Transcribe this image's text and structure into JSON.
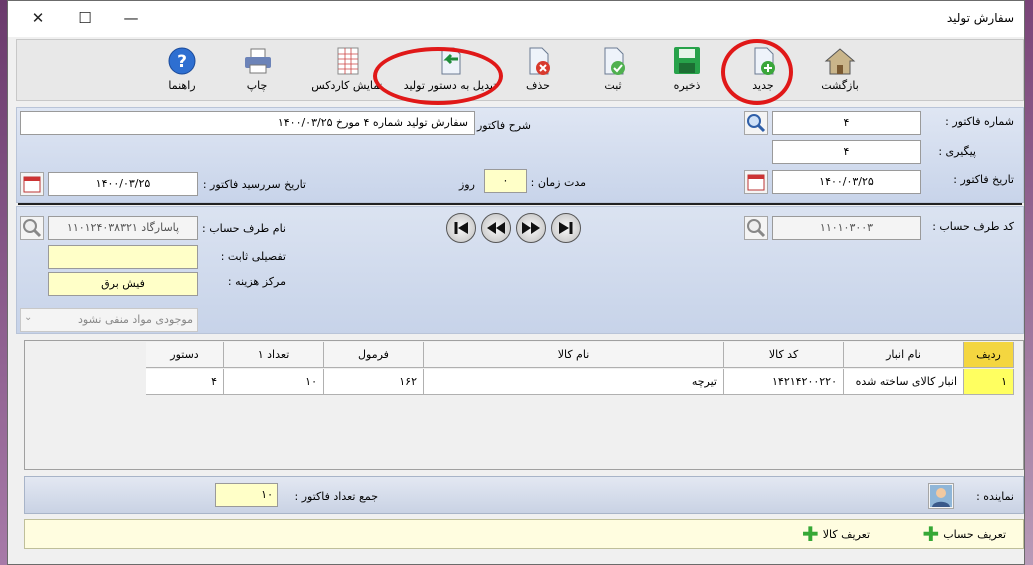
{
  "window": {
    "title": "سفارش تولید",
    "minimize": "—",
    "maximize": "☐",
    "close": "✕"
  },
  "toolbar": {
    "back": "بازگشت",
    "new": "جدید",
    "save": "ذخیره",
    "commit": "ثبت",
    "delete": "حذف",
    "convert": "تبدیل به دستور تولید",
    "kardex": "نمایش کاردکس",
    "print": "چاپ",
    "help": "راهنما"
  },
  "header": {
    "invoice_number_label": "شماره فاکتور :",
    "invoice_number": "۴",
    "tracking_label": "پیگیری :",
    "tracking": "۴",
    "invoice_date_label": "تاریخ فاکتور :",
    "invoice_date": "۱۴۰۰/۰۳/۲۵",
    "description_label": "شرح فاکتور :",
    "description": "سفارش تولید شماره ۴ مورخ ۱۴۰۰/۰۳/۲۵",
    "duration_label": "مدت زمان :",
    "duration": "۰",
    "duration_unit": "روز",
    "due_date_label": "تاریخ سررسید فاکتور :",
    "due_date": "۱۴۰۰/۰۳/۲۵"
  },
  "account": {
    "code_label": "کد طرف حساب :",
    "code": "۱۱۰۱۰۳۰۰۳",
    "name_label": "نام طرف حساب :",
    "name": "پاسارگاد ۱۱۰۱۲۴۰۳۸۳۲۱",
    "detail_label": "تفصیلی ثابت :",
    "detail": "",
    "cost_center_label": "مرکز هزینه :",
    "cost_center": "فیش برق",
    "stock_option": "موجودی مواد منفی نشود"
  },
  "grid": {
    "columns": [
      "ردیف",
      "نام انبار",
      "کد کالا",
      "نام کالا",
      "فرمول",
      "تعداد ۱",
      "دستور"
    ],
    "rows": [
      [
        "۱",
        "انبار کالای ساخته شده",
        "۱۴۲۱۴۲۰۰۲۲۰",
        "تیرچه",
        "۱۶۲",
        "۱۰",
        "۴"
      ]
    ]
  },
  "summary": {
    "agent_label": "نماینده :",
    "total_label": "جمع تعداد فاکتور :",
    "total": "۱۰"
  },
  "footer": {
    "define_account": "تعریف حساب",
    "define_item": "تعریف کالا"
  },
  "colors": {
    "annotation": "#e01818",
    "highlight": "#ffffc8"
  }
}
